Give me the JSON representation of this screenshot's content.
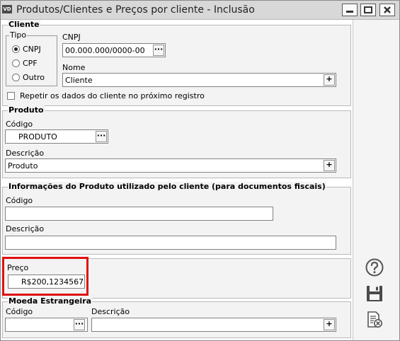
{
  "window": {
    "icon_text": "VD",
    "title": "Produtos/Clientes e Preços por cliente - Inclusão"
  },
  "cliente": {
    "group_label": "Cliente",
    "tipo_label": "Tipo",
    "tipo_options": [
      "CNPJ",
      "CPF",
      "Outro"
    ],
    "tipo_selected": "CNPJ",
    "cnpj_label": "CNPJ",
    "cnpj_value": "00.000.000/0000-00",
    "nome_label": "Nome",
    "nome_value": "Cliente",
    "repeat_label": "Repetir os dados do cliente no próximo registro",
    "repeat_checked": false
  },
  "produto": {
    "group_label": "Produto",
    "codigo_label": "Código",
    "codigo_value": "PRODUTO",
    "descricao_label": "Descrição",
    "descricao_value": "Produto"
  },
  "info_fiscais": {
    "group_label": "Informações do Produto utilizado pelo cliente (para documentos fiscais)",
    "codigo_label": "Código",
    "codigo_value": "",
    "descricao_label": "Descrição",
    "descricao_value": ""
  },
  "preco": {
    "label": "Preço",
    "value": "R$200,1234567",
    "highlight_color": "#e01010"
  },
  "moeda": {
    "group_label": "Moeda Estrangeira",
    "codigo_label": "Código",
    "codigo_value": "",
    "descricao_label": "Descrição",
    "descricao_value": ""
  },
  "buttons": {
    "ellipsis": "···",
    "plus": "+"
  },
  "side_icons": [
    "help-icon",
    "save-icon",
    "cancel-document-icon"
  ]
}
